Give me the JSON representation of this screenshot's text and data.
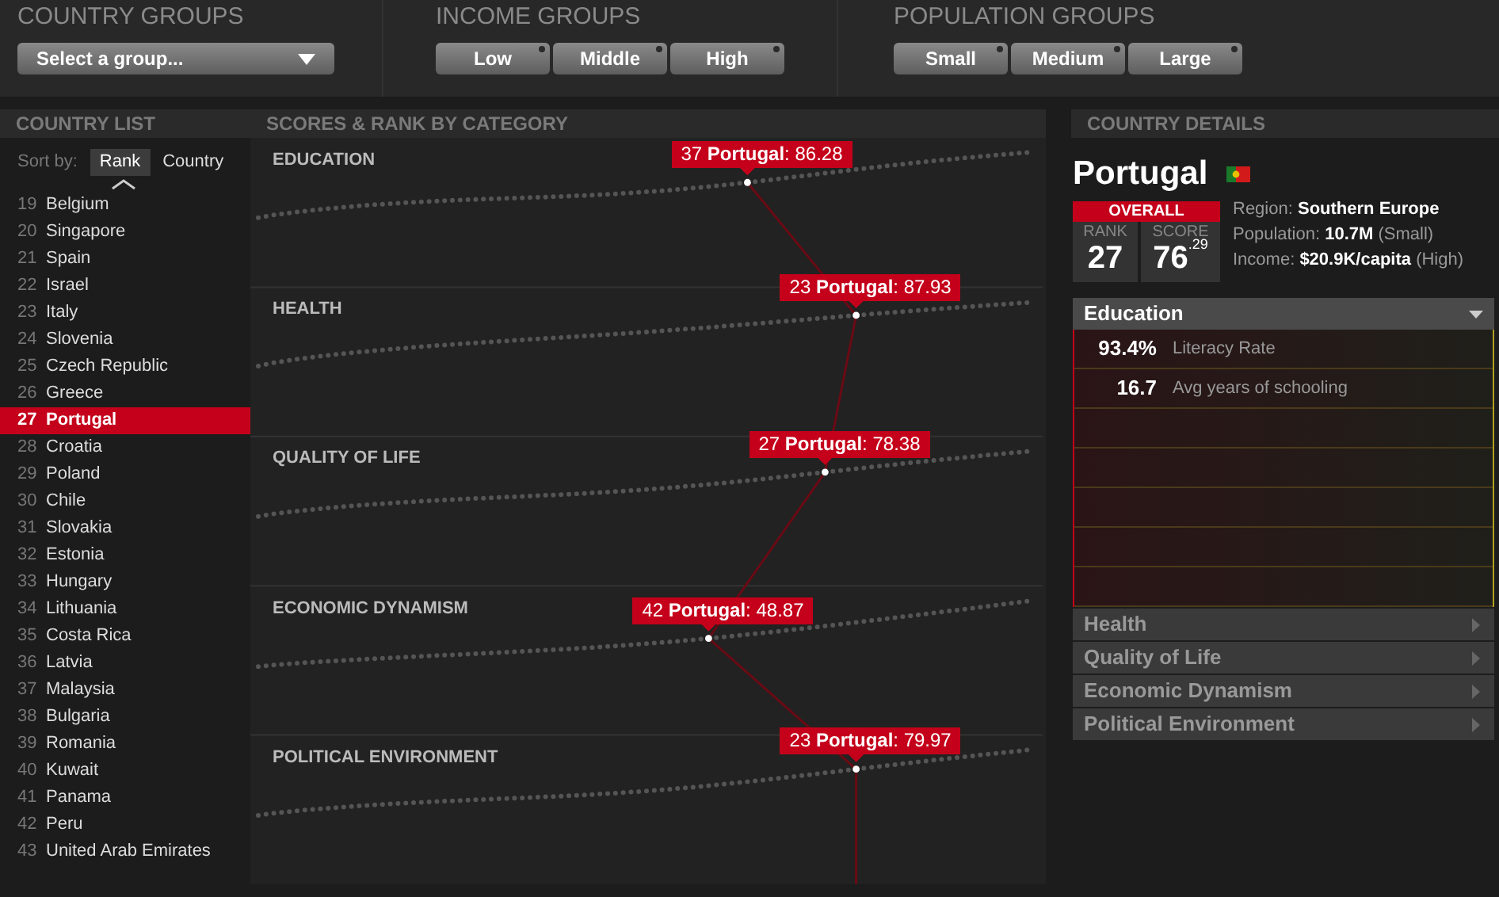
{
  "filters": {
    "country_groups": {
      "title": "COUNTRY GROUPS",
      "placeholder": "Select a group..."
    },
    "income_groups": {
      "title": "INCOME GROUPS",
      "options": [
        "Low",
        "Middle",
        "High"
      ]
    },
    "population_groups": {
      "title": "POPULATION GROUPS",
      "options": [
        "Small",
        "Medium",
        "Large"
      ]
    }
  },
  "country_list": {
    "title": "COUNTRY LIST",
    "sort_label": "Sort by:",
    "sort_options": [
      {
        "label": "Rank",
        "selected": true
      },
      {
        "label": "Country",
        "selected": false
      }
    ],
    "items": [
      {
        "rank": "19",
        "name": "Belgium",
        "selected": false
      },
      {
        "rank": "20",
        "name": "Singapore",
        "selected": false
      },
      {
        "rank": "21",
        "name": "Spain",
        "selected": false
      },
      {
        "rank": "22",
        "name": "Israel",
        "selected": false
      },
      {
        "rank": "23",
        "name": "Italy",
        "selected": false
      },
      {
        "rank": "24",
        "name": "Slovenia",
        "selected": false
      },
      {
        "rank": "25",
        "name": "Czech Republic",
        "selected": false
      },
      {
        "rank": "26",
        "name": "Greece",
        "selected": false
      },
      {
        "rank": "27",
        "name": "Portugal",
        "selected": true
      },
      {
        "rank": "28",
        "name": "Croatia",
        "selected": false
      },
      {
        "rank": "29",
        "name": "Poland",
        "selected": false
      },
      {
        "rank": "30",
        "name": "Chile",
        "selected": false
      },
      {
        "rank": "31",
        "name": "Slovakia",
        "selected": false
      },
      {
        "rank": "32",
        "name": "Estonia",
        "selected": false
      },
      {
        "rank": "33",
        "name": "Hungary",
        "selected": false
      },
      {
        "rank": "34",
        "name": "Lithuania",
        "selected": false
      },
      {
        "rank": "35",
        "name": "Costa Rica",
        "selected": false
      },
      {
        "rank": "36",
        "name": "Latvia",
        "selected": false
      },
      {
        "rank": "37",
        "name": "Malaysia",
        "selected": false
      },
      {
        "rank": "38",
        "name": "Bulgaria",
        "selected": false
      },
      {
        "rank": "39",
        "name": "Romania",
        "selected": false
      },
      {
        "rank": "40",
        "name": "Kuwait",
        "selected": false
      },
      {
        "rank": "41",
        "name": "Panama",
        "selected": false
      },
      {
        "rank": "42",
        "name": "Peru",
        "selected": false
      },
      {
        "rank": "43",
        "name": "United Arab Emirates",
        "selected": false
      }
    ]
  },
  "scores": {
    "title": "SCORES & RANK BY CATEGORY",
    "categories": [
      {
        "label": "EDUCATION",
        "tooltip": "37 **Portugal**: 86.28"
      },
      {
        "label": "HEALTH",
        "tooltip": "23 **Portugal**: 87.93"
      },
      {
        "label": "QUALITY OF LIFE",
        "tooltip": "27 **Portugal**: 78.38"
      },
      {
        "label": "ECONOMIC DYNAMISM",
        "tooltip": "42 **Portugal**: 48.87"
      },
      {
        "label": "POLITICAL ENVIRONMENT",
        "tooltip": "23 **Portugal**: 79.97"
      }
    ]
  },
  "details": {
    "title": "COUNTRY DETAILS",
    "country": "Portugal",
    "overall_label": "OVERALL",
    "rank_label": "RANK",
    "rank": "27",
    "score_label": "SCORE",
    "score_whole": "76",
    "score_decimal": ".29",
    "facts": [
      "Region: **Southern Europe**",
      "Population: **10.7M** (Small)",
      "Income: **$20.9K/capita** (High)"
    ],
    "sections": [
      {
        "title": "Education",
        "expanded": true,
        "indicators": [
          {
            "value": "93.4%",
            "label": "Literacy Rate"
          },
          {
            "value": "16.7",
            "label": "Avg years of schooling"
          }
        ]
      },
      {
        "title": "Health",
        "expanded": false
      },
      {
        "title": "Quality of Life",
        "expanded": false
      },
      {
        "title": "Economic Dynamism",
        "expanded": false
      },
      {
        "title": "Political Environment",
        "expanded": false
      }
    ]
  }
}
